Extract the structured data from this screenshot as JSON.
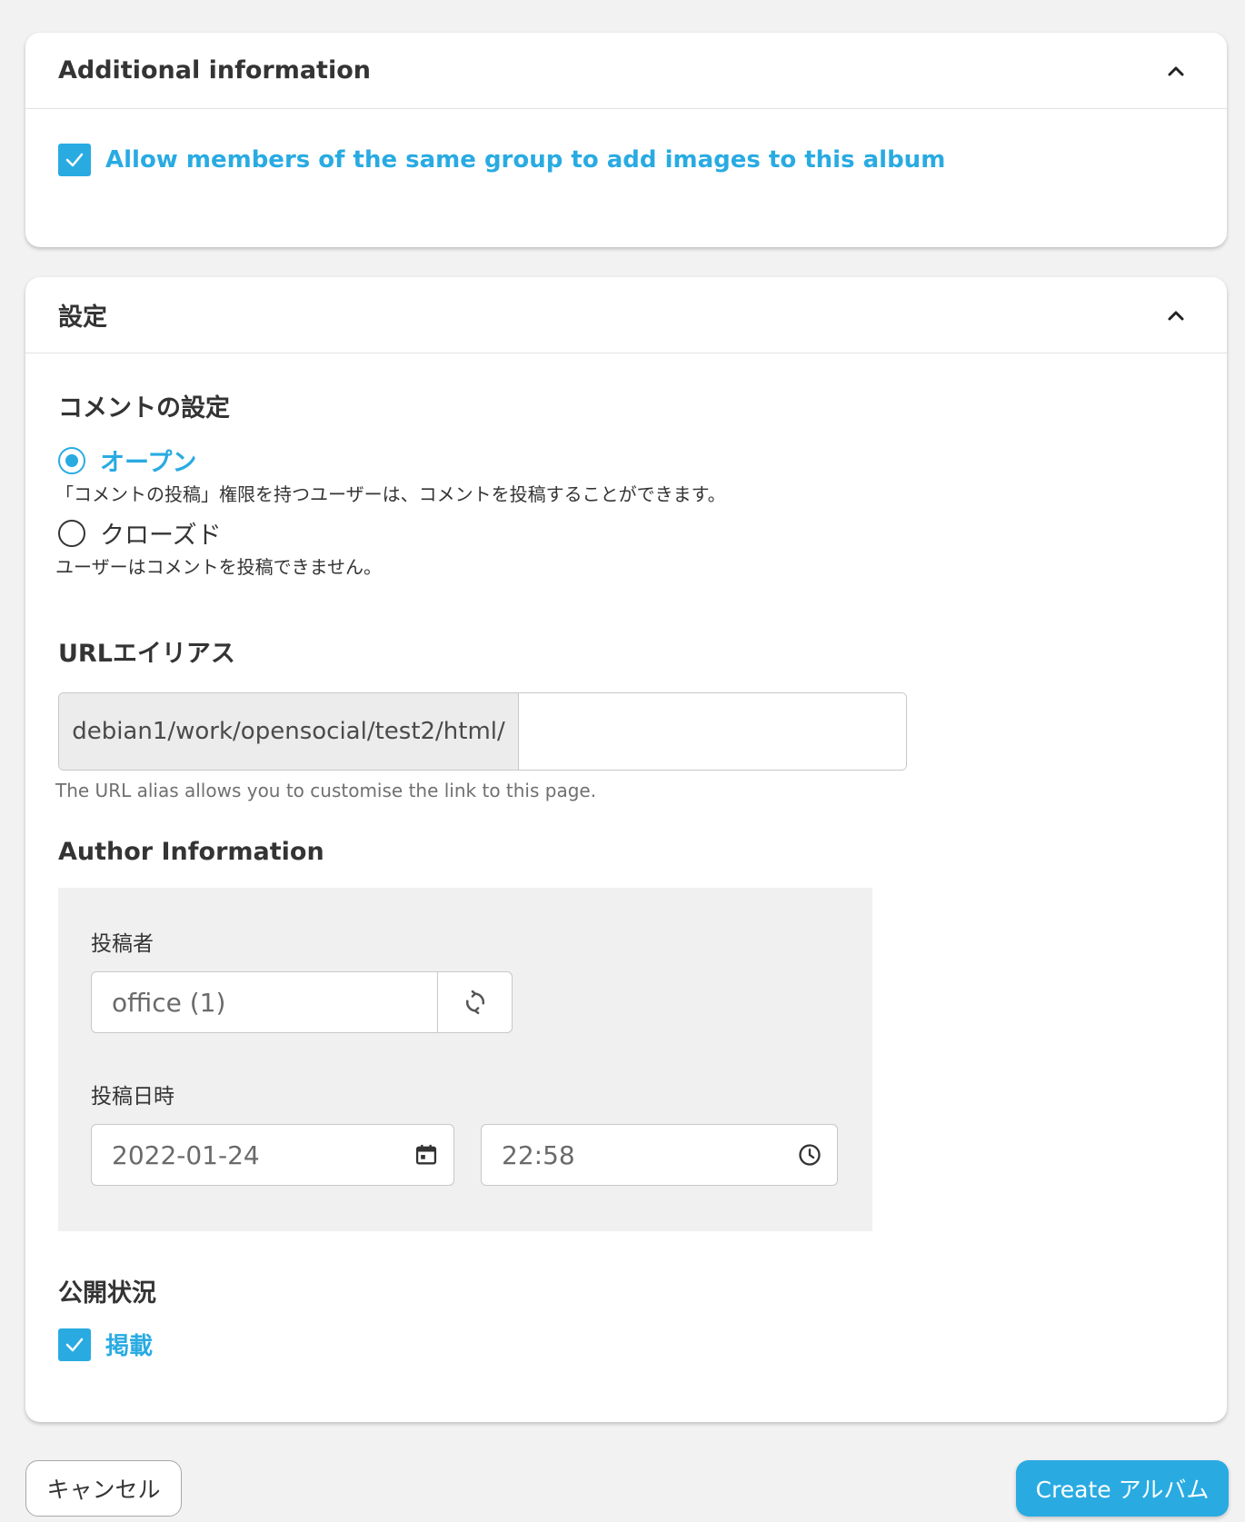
{
  "additional_info": {
    "title": "Additional information",
    "allow_members_label": "Allow members of the same group to add images to this album",
    "allow_members_checked": true
  },
  "settings": {
    "title": "設定",
    "comments": {
      "title": "コメントの設定",
      "options": [
        {
          "label": "オープン",
          "description": "「コメントの投稿」権限を持つユーザーは、コメントを投稿することができます。",
          "selected": true
        },
        {
          "label": "クローズド",
          "description": "ユーザーはコメントを投稿できません。",
          "selected": false
        }
      ]
    },
    "url_alias": {
      "title": "URLエイリアス",
      "prefix": "debian1/work/opensocial/test2/html/",
      "value": "",
      "help": "The URL alias allows you to customise the link to this page."
    },
    "author": {
      "title": "Author Information",
      "authored_by_label": "投稿者",
      "authored_by_value": "office (1)",
      "authored_on_label": "投稿日時",
      "date_value": "2022-01-24",
      "time_value": "22:58"
    },
    "publish": {
      "title": "公開状況",
      "published_label": "掲載",
      "published_checked": true
    }
  },
  "actions": {
    "cancel_label": "キャンセル",
    "create_label": "Create アルバム"
  },
  "colors": {
    "accent": "#29abe2",
    "background": "#f2f2f2",
    "card": "#ffffff",
    "text": "#343434"
  },
  "icons": [
    "chevron-up-icon",
    "check-icon",
    "refresh-icon",
    "calendar-icon",
    "clock-icon"
  ]
}
